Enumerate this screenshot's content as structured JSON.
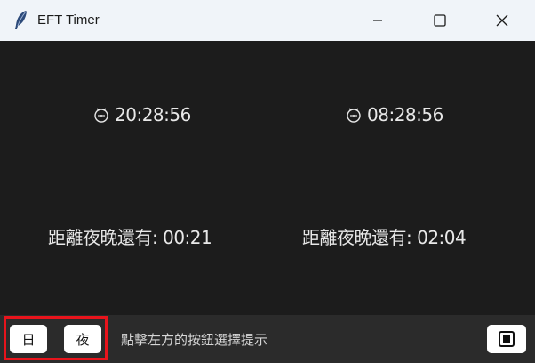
{
  "window": {
    "title": "EFT Timer"
  },
  "clocks": {
    "left": {
      "icon": "clock-face-icon",
      "time": "20:28:56"
    },
    "right": {
      "icon": "clock-face-icon",
      "time": "08:28:56"
    }
  },
  "countdowns": {
    "left": "距離夜晚還有: 00:21",
    "right": "距離夜晚還有: 02:04"
  },
  "bottombar": {
    "day_label": "日",
    "night_label": "夜",
    "hint": "點擊左方的按鈕選擇提示",
    "stop_icon": "stop-square-icon"
  },
  "colors": {
    "background": "#1c1c1c",
    "bottombar": "#2b2b2b",
    "highlight": "#e8141c",
    "text": "#e8e8e8"
  }
}
